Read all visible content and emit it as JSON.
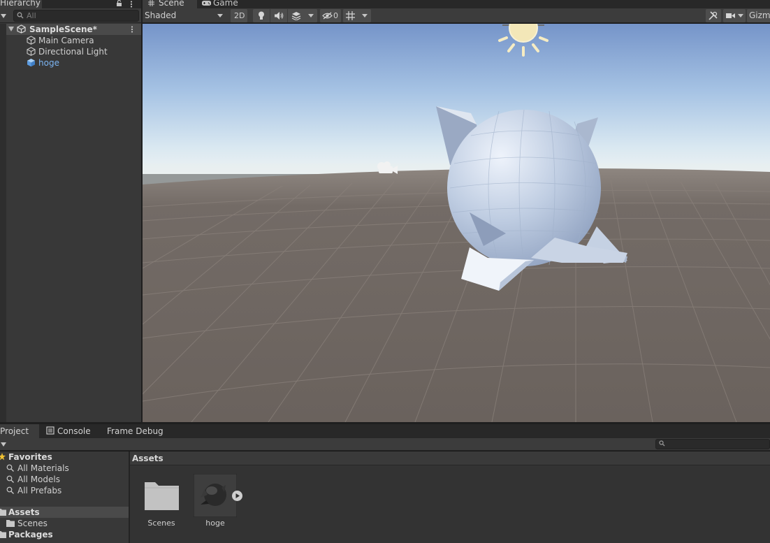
{
  "hierarchy": {
    "tab_label": "Hierarchy",
    "search_placeholder": "All",
    "scene_name": "SampleScene*",
    "items": [
      {
        "label": "Main Camera",
        "selected": false
      },
      {
        "label": "Directional Light",
        "selected": false
      },
      {
        "label": "hoge",
        "selected": true
      }
    ]
  },
  "scene_view": {
    "tabs": [
      {
        "label": "Scene",
        "icon": "grid-hash-icon",
        "active": true
      },
      {
        "label": "Game",
        "icon": "gamepad-icon",
        "active": false
      }
    ],
    "toolbar": {
      "shading_mode": "Shaded",
      "btn_2d": "2D",
      "hidden_count": "0",
      "gizmos_label": "Gizmos"
    },
    "colors": {
      "sky_top": "#7b9bcf",
      "horizon": "#e6eef3",
      "ground": "#6e6661",
      "grid_line": "#8a817c",
      "model": "#b9c7dd",
      "sun": "#f3e7b8"
    }
  },
  "project": {
    "tabs": [
      {
        "label": "Project",
        "active": true
      },
      {
        "label": "Console",
        "active": false
      },
      {
        "label": "Frame Debug",
        "active": false
      }
    ],
    "tree": {
      "favorites_label": "Favorites",
      "favorites": [
        "All Materials",
        "All Models",
        "All Prefabs"
      ],
      "assets_label": "Assets",
      "assets_children": [
        "Scenes"
      ],
      "packages_label": "Packages"
    },
    "breadcrumb": "Assets",
    "assets": [
      {
        "name": "Scenes",
        "kind": "folder"
      },
      {
        "name": "hoge",
        "kind": "model"
      }
    ]
  }
}
